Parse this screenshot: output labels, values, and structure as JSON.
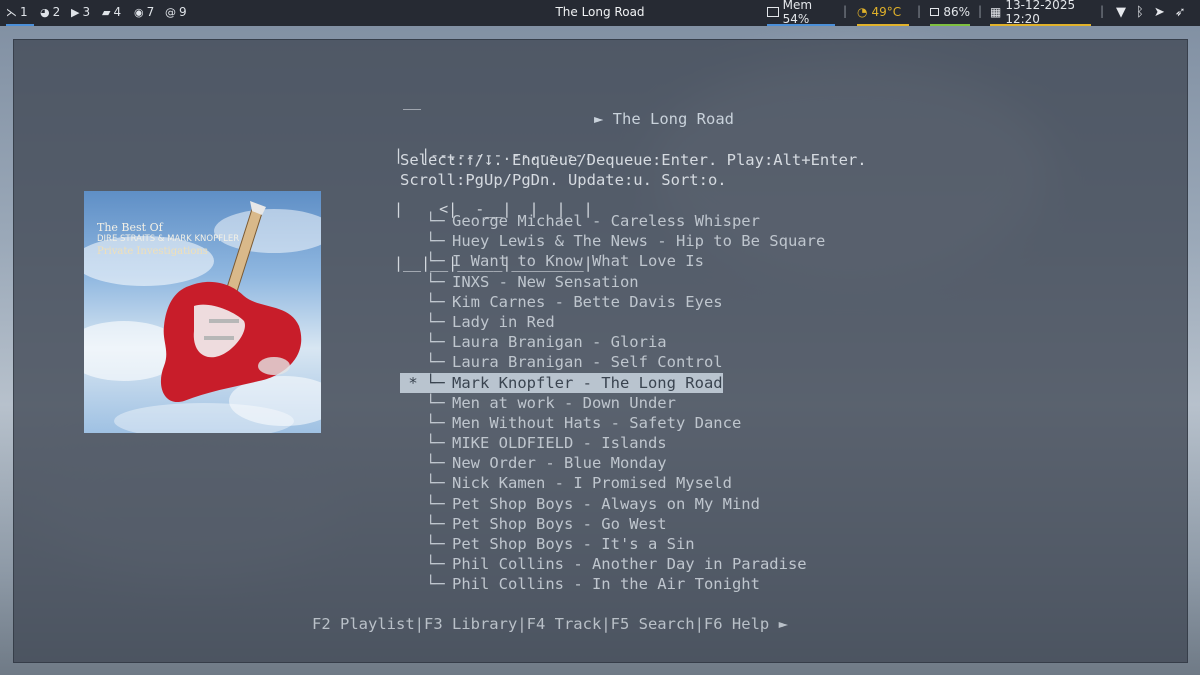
{
  "topbar": {
    "workspaces": [
      {
        "icon": "terminal-icon",
        "glyph": "⋋",
        "label": "1",
        "active": true
      },
      {
        "icon": "dashboard-icon",
        "glyph": "◕",
        "label": "2",
        "active": false
      },
      {
        "icon": "play-icon",
        "glyph": "▶",
        "label": "3",
        "active": false
      },
      {
        "icon": "folder-icon",
        "glyph": "▰",
        "label": "4",
        "active": false
      },
      {
        "icon": "chat-icon",
        "glyph": "◉",
        "label": "7",
        "active": false
      },
      {
        "icon": "mail-icon",
        "glyph": "@",
        "label": "9",
        "active": false
      }
    ],
    "window_title": "The Long Road",
    "memory": "Mem 54%",
    "temperature": "49°C",
    "battery": "86%",
    "datetime": "13-12-2025 12:20",
    "separator": "|",
    "colors": {
      "accent": "#4b8fd8",
      "temp": "#e0b12a",
      "battery": "#7fbf3f"
    }
  },
  "player": {
    "logo_lines": [
      " __",
      "|  |--.-----.--.--.--.",
      "|    <|  -__|  |  |  |",
      "|__|__|_____|________|"
    ],
    "now_playing": "► The Long Road",
    "help_line_1": "Select:↑/↓. Enqueue/Dequeue:Enter. Play:Alt+Enter.",
    "help_line_2": "Scroll:PgUp/PgDn. Update:u. Sort:o.",
    "cover": {
      "line1": "The Best Of",
      "line2": "DIRE STRAITS & MARK KNOPFLER",
      "line3": "Private Investigations"
    },
    "branch": "└─",
    "tracks": [
      {
        "mark": "",
        "title": "George Michael - Careless Whisper",
        "selected": false
      },
      {
        "mark": "",
        "title": "Huey Lewis & The News - Hip to Be Square",
        "selected": false
      },
      {
        "mark": "",
        "title": "I Want to Know What Love Is",
        "selected": false
      },
      {
        "mark": "",
        "title": "INXS - New Sensation",
        "selected": false
      },
      {
        "mark": "",
        "title": "Kim Carnes - Bette Davis Eyes",
        "selected": false
      },
      {
        "mark": "",
        "title": "Lady in Red",
        "selected": false
      },
      {
        "mark": "",
        "title": "Laura Branigan - Gloria",
        "selected": false
      },
      {
        "mark": "",
        "title": "Laura Branigan - Self Control",
        "selected": false
      },
      {
        "mark": "*",
        "title": "Mark Knopfler - The Long Road",
        "selected": true
      },
      {
        "mark": "",
        "title": "Men at work - Down Under",
        "selected": false
      },
      {
        "mark": "",
        "title": "Men Without Hats - Safety Dance",
        "selected": false
      },
      {
        "mark": "",
        "title": "MIKE OLDFIELD - Islands",
        "selected": false
      },
      {
        "mark": "",
        "title": "New Order - Blue Monday",
        "selected": false
      },
      {
        "mark": "",
        "title": "Nick Kamen - I Promised Myseld",
        "selected": false
      },
      {
        "mark": "",
        "title": "Pet Shop Boys - Always on My Mind",
        "selected": false
      },
      {
        "mark": "",
        "title": "Pet Shop Boys - Go West",
        "selected": false
      },
      {
        "mark": "",
        "title": "Pet Shop Boys - It's a Sin",
        "selected": false
      },
      {
        "mark": "",
        "title": "Phil Collins - Another Day in Paradise",
        "selected": false
      },
      {
        "mark": "",
        "title": "Phil Collins - In the Air Tonight",
        "selected": false
      }
    ],
    "fkeys": "F2 Playlist|F3 Library|F4 Track|F5 Search|F6 Help ►"
  }
}
